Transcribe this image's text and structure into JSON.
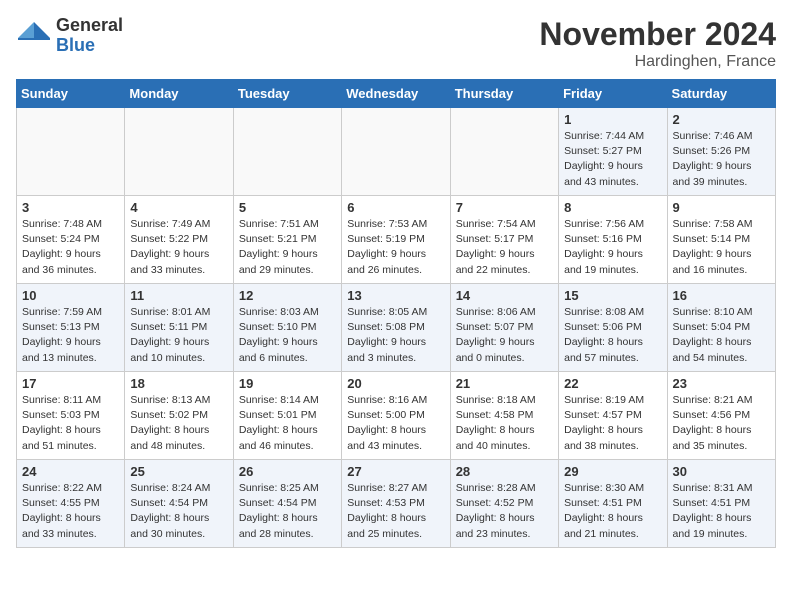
{
  "header": {
    "logo_line1": "General",
    "logo_line2": "Blue",
    "month_title": "November 2024",
    "location": "Hardinghen, France"
  },
  "weekdays": [
    "Sunday",
    "Monday",
    "Tuesday",
    "Wednesday",
    "Thursday",
    "Friday",
    "Saturday"
  ],
  "weeks": [
    [
      {
        "day": "",
        "info": ""
      },
      {
        "day": "",
        "info": ""
      },
      {
        "day": "",
        "info": ""
      },
      {
        "day": "",
        "info": ""
      },
      {
        "day": "",
        "info": ""
      },
      {
        "day": "1",
        "info": "Sunrise: 7:44 AM\nSunset: 5:27 PM\nDaylight: 9 hours\nand 43 minutes."
      },
      {
        "day": "2",
        "info": "Sunrise: 7:46 AM\nSunset: 5:26 PM\nDaylight: 9 hours\nand 39 minutes."
      }
    ],
    [
      {
        "day": "3",
        "info": "Sunrise: 7:48 AM\nSunset: 5:24 PM\nDaylight: 9 hours\nand 36 minutes."
      },
      {
        "day": "4",
        "info": "Sunrise: 7:49 AM\nSunset: 5:22 PM\nDaylight: 9 hours\nand 33 minutes."
      },
      {
        "day": "5",
        "info": "Sunrise: 7:51 AM\nSunset: 5:21 PM\nDaylight: 9 hours\nand 29 minutes."
      },
      {
        "day": "6",
        "info": "Sunrise: 7:53 AM\nSunset: 5:19 PM\nDaylight: 9 hours\nand 26 minutes."
      },
      {
        "day": "7",
        "info": "Sunrise: 7:54 AM\nSunset: 5:17 PM\nDaylight: 9 hours\nand 22 minutes."
      },
      {
        "day": "8",
        "info": "Sunrise: 7:56 AM\nSunset: 5:16 PM\nDaylight: 9 hours\nand 19 minutes."
      },
      {
        "day": "9",
        "info": "Sunrise: 7:58 AM\nSunset: 5:14 PM\nDaylight: 9 hours\nand 16 minutes."
      }
    ],
    [
      {
        "day": "10",
        "info": "Sunrise: 7:59 AM\nSunset: 5:13 PM\nDaylight: 9 hours\nand 13 minutes."
      },
      {
        "day": "11",
        "info": "Sunrise: 8:01 AM\nSunset: 5:11 PM\nDaylight: 9 hours\nand 10 minutes."
      },
      {
        "day": "12",
        "info": "Sunrise: 8:03 AM\nSunset: 5:10 PM\nDaylight: 9 hours\nand 6 minutes."
      },
      {
        "day": "13",
        "info": "Sunrise: 8:05 AM\nSunset: 5:08 PM\nDaylight: 9 hours\nand 3 minutes."
      },
      {
        "day": "14",
        "info": "Sunrise: 8:06 AM\nSunset: 5:07 PM\nDaylight: 9 hours\nand 0 minutes."
      },
      {
        "day": "15",
        "info": "Sunrise: 8:08 AM\nSunset: 5:06 PM\nDaylight: 8 hours\nand 57 minutes."
      },
      {
        "day": "16",
        "info": "Sunrise: 8:10 AM\nSunset: 5:04 PM\nDaylight: 8 hours\nand 54 minutes."
      }
    ],
    [
      {
        "day": "17",
        "info": "Sunrise: 8:11 AM\nSunset: 5:03 PM\nDaylight: 8 hours\nand 51 minutes."
      },
      {
        "day": "18",
        "info": "Sunrise: 8:13 AM\nSunset: 5:02 PM\nDaylight: 8 hours\nand 48 minutes."
      },
      {
        "day": "19",
        "info": "Sunrise: 8:14 AM\nSunset: 5:01 PM\nDaylight: 8 hours\nand 46 minutes."
      },
      {
        "day": "20",
        "info": "Sunrise: 8:16 AM\nSunset: 5:00 PM\nDaylight: 8 hours\nand 43 minutes."
      },
      {
        "day": "21",
        "info": "Sunrise: 8:18 AM\nSunset: 4:58 PM\nDaylight: 8 hours\nand 40 minutes."
      },
      {
        "day": "22",
        "info": "Sunrise: 8:19 AM\nSunset: 4:57 PM\nDaylight: 8 hours\nand 38 minutes."
      },
      {
        "day": "23",
        "info": "Sunrise: 8:21 AM\nSunset: 4:56 PM\nDaylight: 8 hours\nand 35 minutes."
      }
    ],
    [
      {
        "day": "24",
        "info": "Sunrise: 8:22 AM\nSunset: 4:55 PM\nDaylight: 8 hours\nand 33 minutes."
      },
      {
        "day": "25",
        "info": "Sunrise: 8:24 AM\nSunset: 4:54 PM\nDaylight: 8 hours\nand 30 minutes."
      },
      {
        "day": "26",
        "info": "Sunrise: 8:25 AM\nSunset: 4:54 PM\nDaylight: 8 hours\nand 28 minutes."
      },
      {
        "day": "27",
        "info": "Sunrise: 8:27 AM\nSunset: 4:53 PM\nDaylight: 8 hours\nand 25 minutes."
      },
      {
        "day": "28",
        "info": "Sunrise: 8:28 AM\nSunset: 4:52 PM\nDaylight: 8 hours\nand 23 minutes."
      },
      {
        "day": "29",
        "info": "Sunrise: 8:30 AM\nSunset: 4:51 PM\nDaylight: 8 hours\nand 21 minutes."
      },
      {
        "day": "30",
        "info": "Sunrise: 8:31 AM\nSunset: 4:51 PM\nDaylight: 8 hours\nand 19 minutes."
      }
    ]
  ]
}
